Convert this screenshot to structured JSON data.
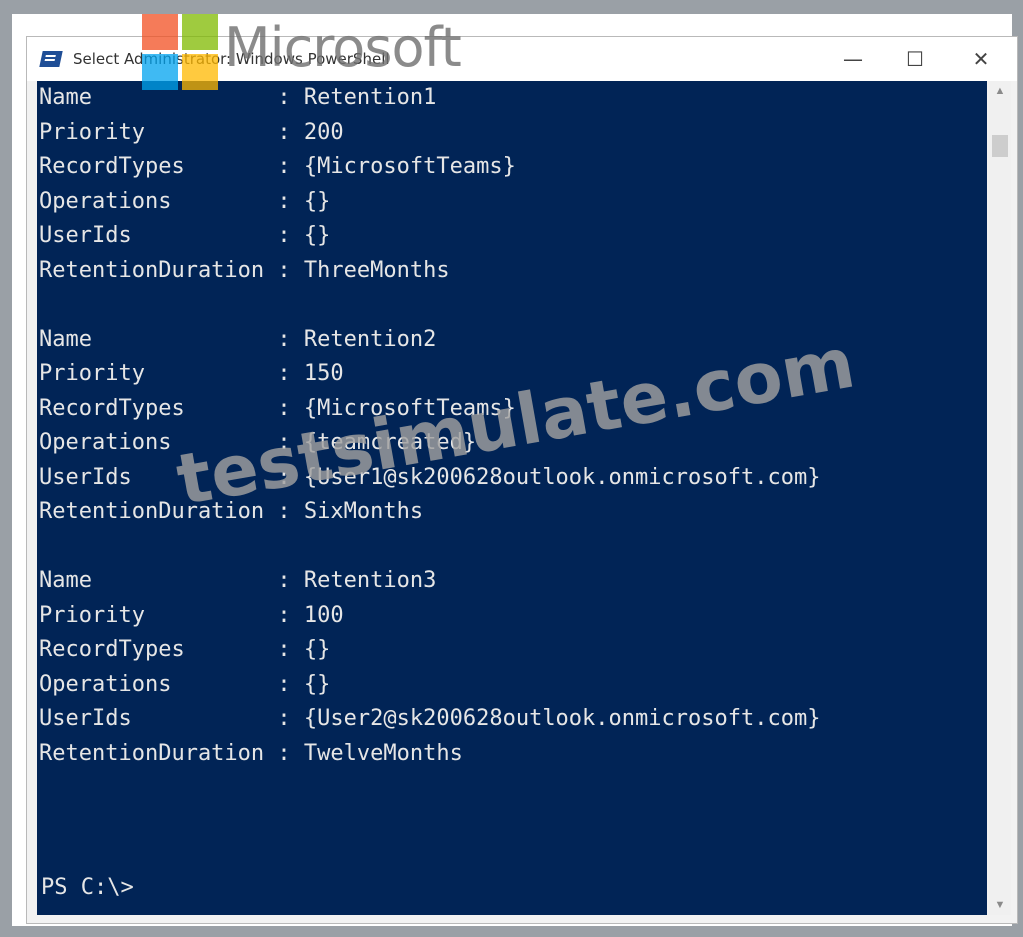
{
  "window": {
    "title": "Select Administrator: Windows PowerShell",
    "minimize_glyph": "—",
    "maximize_glyph": "☐",
    "close_glyph": "✕"
  },
  "console": {
    "lines": [
      "Name              : Retention1",
      "Priority          : 200",
      "RecordTypes       : {MicrosoftTeams}",
      "Operations        : {}",
      "UserIds           : {}",
      "RetentionDuration : ThreeMonths",
      "",
      "Name              : Retention2",
      "Priority          : 150",
      "RecordTypes       : {MicrosoftTeams}",
      "Operations        : {teamcreated}",
      "UserIds           : {User1@sk200628outlook.onmicrosoft.com}",
      "RetentionDuration : SixMonths",
      "",
      "Name              : Retention3",
      "Priority          : 100",
      "RecordTypes       : {}",
      "Operations        : {}",
      "UserIds           : {User2@sk200628outlook.onmicrosoft.com}",
      "RetentionDuration : TwelveMonths"
    ],
    "prompt": "PS C:\\>"
  },
  "scrollbar": {
    "up_glyph": "▲",
    "down_glyph": "▼"
  },
  "overlay": {
    "brand_text": "Microsoft",
    "watermark_text": "testsimulate.com"
  },
  "colors": {
    "console_background": "#012456",
    "console_text": "#e6e6e6"
  }
}
